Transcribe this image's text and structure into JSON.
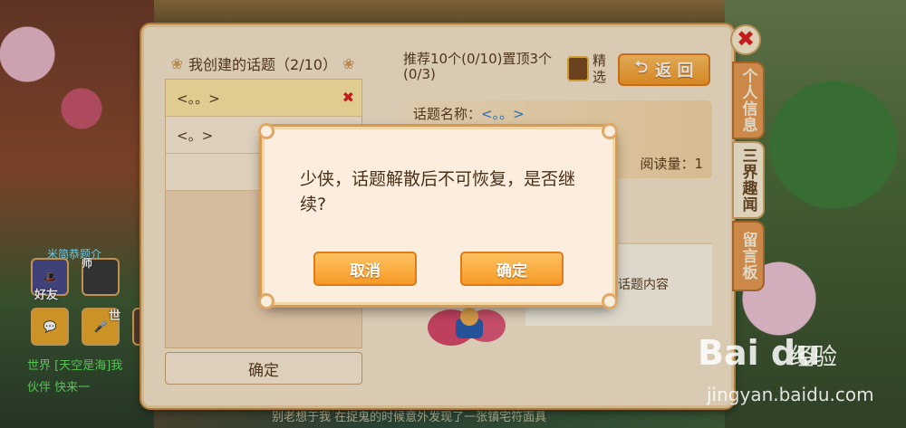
{
  "background": {
    "hud_label": "米简恭题介",
    "hud_friend": "好友",
    "hud_master": "师",
    "hud_world": "世",
    "world_chat": "世界 [天空是海]我",
    "world_chat2": "伙伴    快来一",
    "bottom_chat": "别老想于我  在捉鬼的时候意外发现了一张镇宅符面具"
  },
  "left": {
    "title": "我创建的话题（2/10）",
    "topics": [
      {
        "label": "<。。>",
        "selected": true
      },
      {
        "label": "<。>",
        "selected": false
      }
    ],
    "confirm_label": "确定"
  },
  "right": {
    "recommend_text": "推荐10个(0/10)置顶3个(0/3)",
    "featured_label": "精选",
    "back_label": "返 回",
    "topic_name_label": "话题名称：",
    "topic_name_value": "<。。>",
    "read_count": "阅读量：1",
    "no_content": "前暂无话题内容"
  },
  "tabs": [
    {
      "label": "个人信息",
      "active": false
    },
    {
      "label": "三界趣闻",
      "active": true
    },
    {
      "label": "留言板",
      "active": false
    }
  ],
  "close_icon": "close-icon",
  "dialog": {
    "message": "少侠，话题解散后不可恢复，是否继续?",
    "cancel_label": "取消",
    "confirm_label": "确定"
  },
  "watermark": {
    "logo": "Bai du",
    "sub": "经验",
    "url": "jingyan.baidu.com"
  },
  "colors": {
    "panel": "#f6e6cc",
    "accent": "#f59a25",
    "close": "#e02020",
    "link": "#2a7fd0"
  }
}
